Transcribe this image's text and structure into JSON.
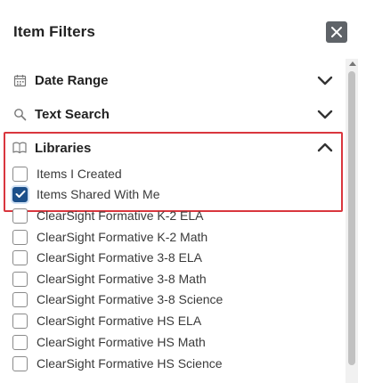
{
  "header": {
    "title": "Item Filters",
    "close_icon": "close-icon"
  },
  "sections": [
    {
      "label": "Date Range",
      "icon": "calendar-icon",
      "state": "collapsed"
    },
    {
      "label": "Text Search",
      "icon": "search-icon",
      "state": "collapsed"
    },
    {
      "label": "Libraries",
      "icon": "book-icon",
      "state": "expanded"
    }
  ],
  "libraries": {
    "items": [
      {
        "label": "Items I Created",
        "checked": false
      },
      {
        "label": "Items Shared With Me",
        "checked": true
      },
      {
        "label": "ClearSight Formative K-2 ELA",
        "checked": false
      },
      {
        "label": "ClearSight Formative K-2 Math",
        "checked": false
      },
      {
        "label": "ClearSight Formative 3-8 ELA",
        "checked": false
      },
      {
        "label": "ClearSight Formative 3-8 Math",
        "checked": false
      },
      {
        "label": "ClearSight Formative 3-8 Science",
        "checked": false
      },
      {
        "label": "ClearSight Formative HS ELA",
        "checked": false
      },
      {
        "label": "ClearSight Formative HS Math",
        "checked": false
      },
      {
        "label": "ClearSight Formative HS Science",
        "checked": false
      }
    ]
  },
  "colors": {
    "accent": "#1b4f8a",
    "highlight": "#d9363e",
    "close_bg": "#5f6368"
  }
}
